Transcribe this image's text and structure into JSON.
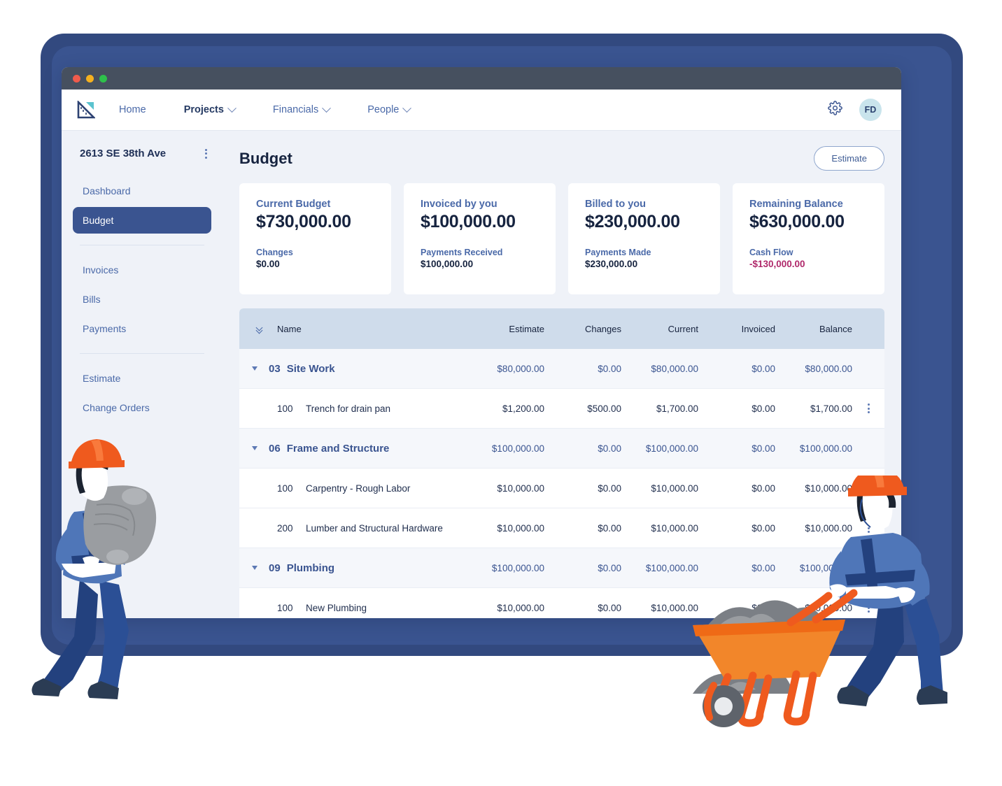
{
  "window": {
    "traffic_lights": [
      "close",
      "minimize",
      "maximize"
    ]
  },
  "topnav": {
    "logo_name": "set-square-logo",
    "links": [
      {
        "label": "Home",
        "has_chevron": false,
        "active": false
      },
      {
        "label": "Projects",
        "has_chevron": true,
        "active": true
      },
      {
        "label": "Financials",
        "has_chevron": true,
        "active": false
      },
      {
        "label": "People",
        "has_chevron": true,
        "active": false
      }
    ],
    "settings_icon": "gear-icon",
    "avatar_initials": "FD"
  },
  "sidebar": {
    "project_title": "2613 SE 38th Ave",
    "more_icon": "kebab-menu-icon",
    "groups": [
      {
        "items": [
          {
            "label": "Dashboard",
            "active": false
          },
          {
            "label": "Budget",
            "active": true
          }
        ]
      },
      {
        "items": [
          {
            "label": "Invoices",
            "active": false
          },
          {
            "label": "Bills",
            "active": false
          },
          {
            "label": "Payments",
            "active": false
          }
        ]
      },
      {
        "items": [
          {
            "label": "Estimate",
            "active": false
          },
          {
            "label": "Change Orders",
            "active": false
          }
        ]
      }
    ]
  },
  "main": {
    "page_title": "Budget",
    "estimate_button": "Estimate",
    "cards": [
      {
        "label": "Current Budget",
        "value": "$730,000.00",
        "sub_label": "Changes",
        "sub_value": "$0.00",
        "negative": false
      },
      {
        "label": "Invoiced by you",
        "value": "$100,000.00",
        "sub_label": "Payments Received",
        "sub_value": "$100,000.00",
        "negative": false
      },
      {
        "label": "Billed to you",
        "value": "$230,000.00",
        "sub_label": "Payments Made",
        "sub_value": "$230,000.00",
        "negative": false
      },
      {
        "label": "Remaining Balance",
        "value": "$630,000.00",
        "sub_label": "Cash Flow",
        "sub_value": "-$130,000.00",
        "negative": true
      }
    ],
    "table": {
      "collapse_icon": "double-chevron-down-icon",
      "columns": [
        "Name",
        "Estimate",
        "Changes",
        "Current",
        "Invoiced",
        "Balance"
      ],
      "rows": [
        {
          "type": "group",
          "code": "03",
          "name": "Site Work",
          "estimate": "$80,000.00",
          "changes": "$0.00",
          "current": "$80,000.00",
          "invoiced": "$0.00",
          "balance": "$80,000.00"
        },
        {
          "type": "item",
          "code": "100",
          "name": "Trench for drain pan",
          "estimate": "$1,200.00",
          "changes": "$500.00",
          "current": "$1,700.00",
          "invoiced": "$0.00",
          "balance": "$1,700.00"
        },
        {
          "type": "group",
          "code": "06",
          "name": "Frame and Structure",
          "estimate": "$100,000.00",
          "changes": "$0.00",
          "current": "$100,000.00",
          "invoiced": "$0.00",
          "balance": "$100,000.00"
        },
        {
          "type": "item",
          "code": "100",
          "name": "Carpentry - Rough Labor",
          "estimate": "$10,000.00",
          "changes": "$0.00",
          "current": "$10,000.00",
          "invoiced": "$0.00",
          "balance": "$10,000.00"
        },
        {
          "type": "item",
          "code": "200",
          "name": "Lumber and Structural Hardware",
          "estimate": "$10,000.00",
          "changes": "$0.00",
          "current": "$10,000.00",
          "invoiced": "$0.00",
          "balance": "$10,000.00"
        },
        {
          "type": "group",
          "code": "09",
          "name": "Plumbing",
          "estimate": "$100,000.00",
          "changes": "$0.00",
          "current": "$100,000.00",
          "invoiced": "$0.00",
          "balance": "$100,000.00"
        },
        {
          "type": "item",
          "code": "100",
          "name": "New Plumbing",
          "estimate": "$10,000.00",
          "changes": "$0.00",
          "current": "$10,000.00",
          "invoiced": "$0.00",
          "balance": "$10,000.00"
        }
      ]
    }
  },
  "illustrations": [
    {
      "name": "worker-carrying-cement-bag"
    },
    {
      "name": "worker-pushing-wheelbarrow"
    }
  ],
  "colors": {
    "frame_blue": "#32497f",
    "brand_navy": "#3a5490",
    "link_blue": "#4a69a8",
    "text_navy": "#16233f",
    "table_header": "#cfdceb",
    "negative": "#b0296b",
    "hardhat_orange": "#ef5a1e",
    "avatar_bg": "#c9e4ec"
  }
}
